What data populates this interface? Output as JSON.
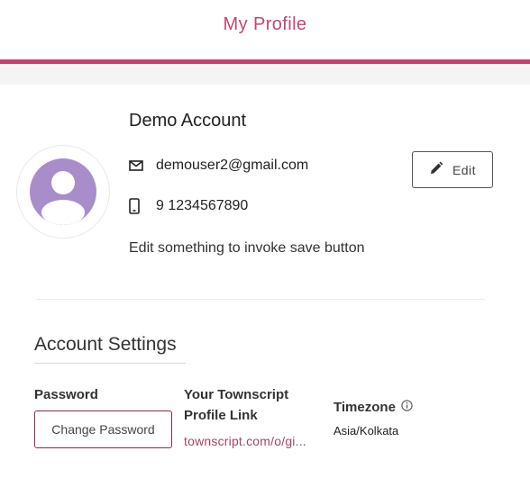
{
  "header": {
    "title": "My Profile",
    "accent_color": "#c8416c"
  },
  "profile": {
    "name": "Demo Account",
    "email": "demouser2@gmail.com",
    "email_icon": "mail-icon",
    "phone": "9 1234567890",
    "phone_icon": "smartphone-icon",
    "hint": "Edit something to invoke save button",
    "avatar_icon": "user-avatar-icon",
    "avatar_color": "#a98dcb",
    "edit_label": "Edit",
    "edit_icon": "pencil-icon"
  },
  "account_settings": {
    "title": "Account Settings",
    "password_label": "Password",
    "change_password_label": "Change Password",
    "profile_link_label": "Your Townscript Profile Link",
    "profile_link_text": "townscript.com/o/gi...",
    "timezone_label": "Timezone",
    "timezone_info_icon": "info-icon",
    "timezone_value": "Asia/Kolkata"
  }
}
